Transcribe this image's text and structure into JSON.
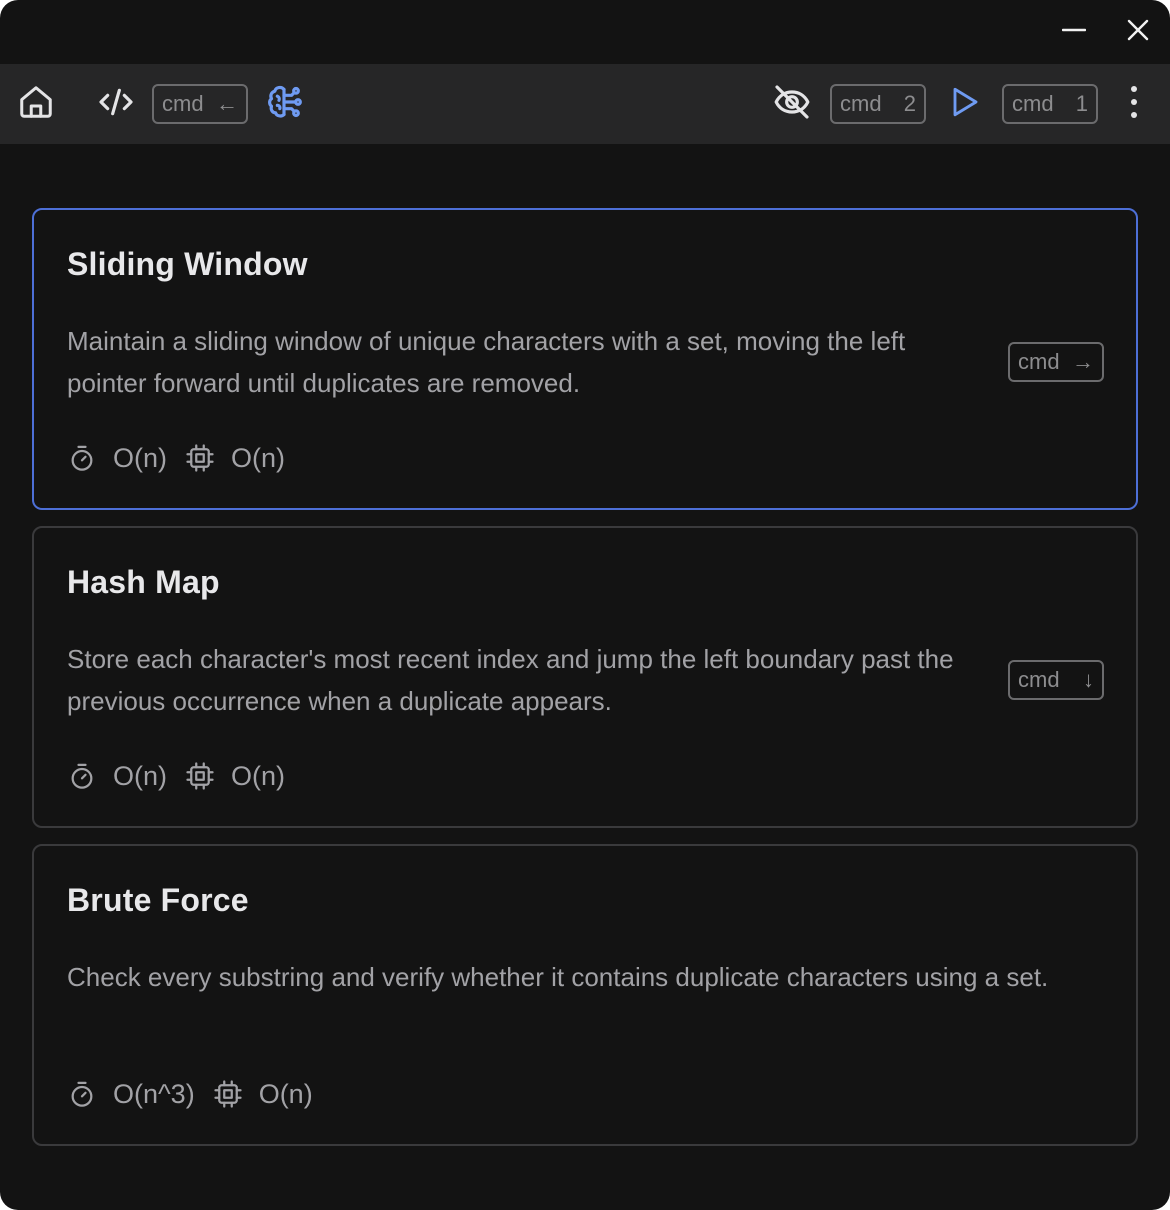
{
  "toolbar": {
    "code_shortcut": {
      "mod": "cmd",
      "key": "←"
    },
    "hide_shortcut": {
      "mod": "cmd",
      "key": "2"
    },
    "run_shortcut": {
      "mod": "cmd",
      "key": "1"
    },
    "icons": [
      "home-icon",
      "code-icon",
      "brain-icon",
      "eye-off-icon",
      "play-icon",
      "more-vertical-icon"
    ],
    "accent_color": "#6f9bf2"
  },
  "window_controls": [
    "minimize-icon",
    "close-icon"
  ],
  "approaches": [
    {
      "title": "Sliding Window",
      "description": "Maintain a sliding window of unique characters with a set, moving the left pointer forward until duplicates are removed.",
      "time": "O(n)",
      "space": "O(n)",
      "shortcut": {
        "mod": "cmd",
        "key": "→"
      },
      "selected": true
    },
    {
      "title": "Hash Map",
      "description": "Store each character's most recent index and jump the left boundary past the previous occurrence when a duplicate appears.",
      "time": "O(n)",
      "space": "O(n)",
      "shortcut": {
        "mod": "cmd",
        "key": "↓"
      },
      "selected": false
    },
    {
      "title": "Brute Force",
      "description": "Check every substring and verify whether it contains duplicate characters using a set.",
      "time": "O(n^3)",
      "space": "O(n)",
      "shortcut": null,
      "selected": false
    }
  ],
  "colors": {
    "background": "#131313",
    "toolbar": "#262627",
    "selected_border": "#4d6fd6",
    "card_border": "#3a3a3c"
  }
}
